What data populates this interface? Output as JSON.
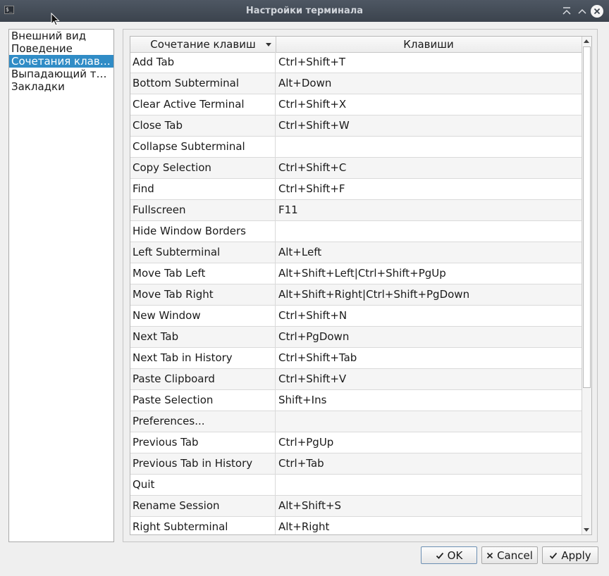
{
  "window": {
    "title": "Настройки терминала"
  },
  "sidebar": {
    "items": [
      {
        "label": "Внешний вид",
        "selected": false
      },
      {
        "label": "Поведение",
        "selected": false
      },
      {
        "label": "Сочетания клав…",
        "selected": true
      },
      {
        "label": "Выпадающий т…",
        "selected": false
      },
      {
        "label": "Закладки",
        "selected": false
      }
    ]
  },
  "table": {
    "headers": {
      "shortcut": "Сочетание клавиш",
      "keys": "Клавиши"
    },
    "sort_column": "shortcut",
    "rows": [
      {
        "action": "Add Tab",
        "keys": "Ctrl+Shift+T"
      },
      {
        "action": "Bottom Subterminal",
        "keys": "Alt+Down"
      },
      {
        "action": "Clear Active Terminal",
        "keys": "Ctrl+Shift+X"
      },
      {
        "action": "Close Tab",
        "keys": "Ctrl+Shift+W"
      },
      {
        "action": "Collapse Subterminal",
        "keys": ""
      },
      {
        "action": "Copy Selection",
        "keys": "Ctrl+Shift+C"
      },
      {
        "action": "Find",
        "keys": "Ctrl+Shift+F"
      },
      {
        "action": "Fullscreen",
        "keys": "F11"
      },
      {
        "action": "Hide Window Borders",
        "keys": ""
      },
      {
        "action": "Left Subterminal",
        "keys": "Alt+Left"
      },
      {
        "action": "Move Tab Left",
        "keys": "Alt+Shift+Left|Ctrl+Shift+PgUp"
      },
      {
        "action": "Move Tab Right",
        "keys": "Alt+Shift+Right|Ctrl+Shift+PgDown"
      },
      {
        "action": "New Window",
        "keys": "Ctrl+Shift+N"
      },
      {
        "action": "Next Tab",
        "keys": "Ctrl+PgDown"
      },
      {
        "action": "Next Tab in History",
        "keys": "Ctrl+Shift+Tab"
      },
      {
        "action": "Paste Clipboard",
        "keys": "Ctrl+Shift+V"
      },
      {
        "action": "Paste Selection",
        "keys": "Shift+Ins"
      },
      {
        "action": "Preferences...",
        "keys": ""
      },
      {
        "action": "Previous Tab",
        "keys": "Ctrl+PgUp"
      },
      {
        "action": "Previous Tab in History",
        "keys": "Ctrl+Tab"
      },
      {
        "action": "Quit",
        "keys": ""
      },
      {
        "action": "Rename Session",
        "keys": "Alt+Shift+S"
      },
      {
        "action": "Right Subterminal",
        "keys": "Alt+Right"
      }
    ]
  },
  "buttons": {
    "ok": "OK",
    "cancel": "Cancel",
    "apply": "Apply"
  },
  "colors": {
    "selection": "#308cc6",
    "titlebar": "#3b434d"
  }
}
